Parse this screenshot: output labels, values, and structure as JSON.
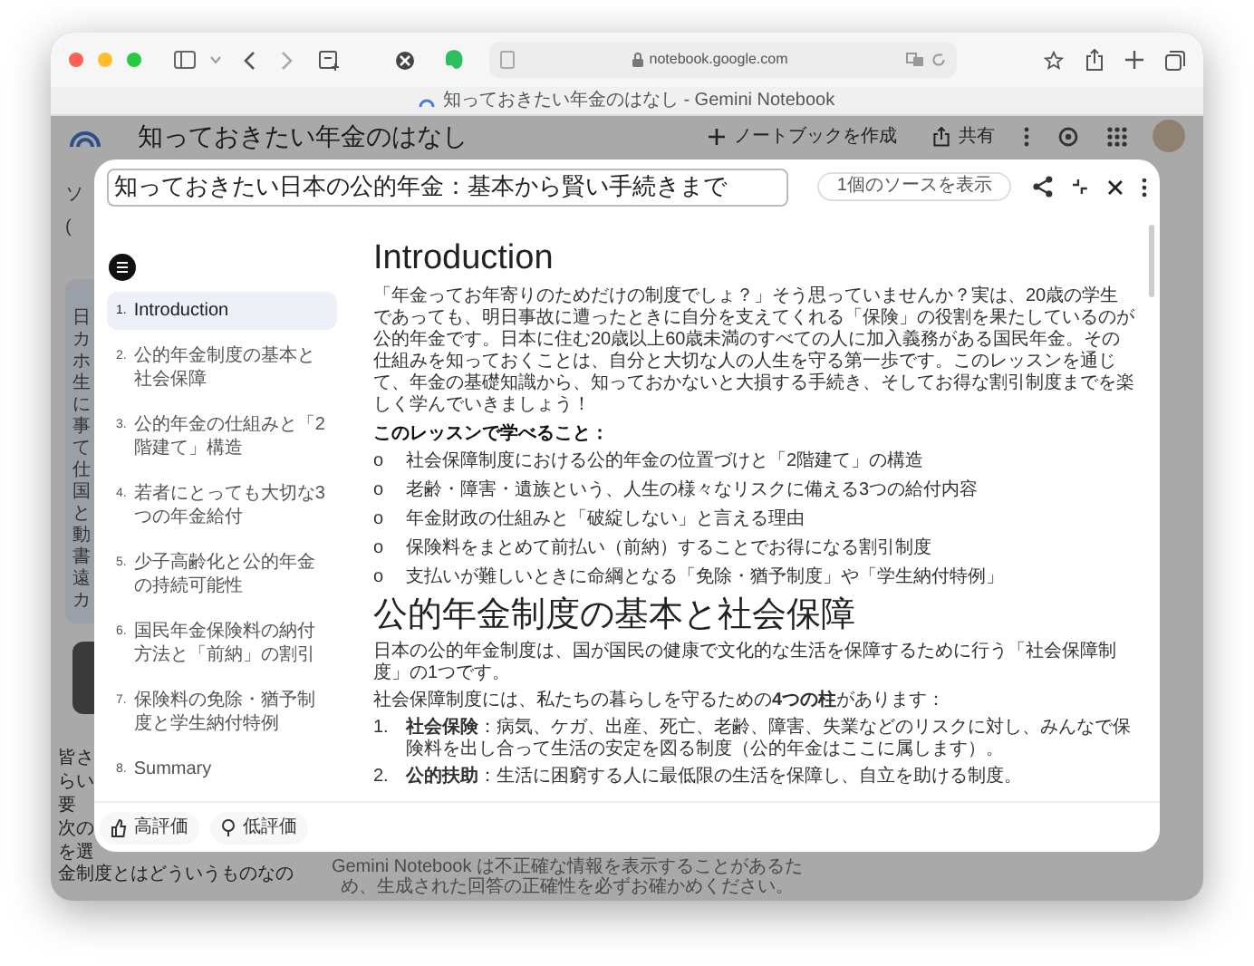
{
  "browser": {
    "url": "notebook.google.com",
    "tab_title": "知っておきたい年金のはなし - Gemini Notebook"
  },
  "app_header": {
    "title": "知っておきたい年金のはなし",
    "create_button": "ノートブックを作成",
    "share_button": "共有"
  },
  "backdrop": {
    "top_fragments": [
      "ソ",
      "("
    ],
    "card_fragments": [
      "日",
      "カ",
      "ホ",
      "生",
      "に",
      "事",
      "て",
      "仕",
      "国",
      "と",
      "動",
      "書",
      "遠",
      "カ"
    ],
    "bottom_fragments": [
      "皆さ",
      "らい",
      "要",
      "次の",
      "を選"
    ],
    "last_line": "金制度とはどういうものなの"
  },
  "modal": {
    "title_value": "知っておきたい日本の公的年金：基本から賢い手続きまで",
    "sources_button": "1個のソースを表示",
    "toc": [
      {
        "number": "1.",
        "label": "Introduction",
        "selected": true
      },
      {
        "number": "2.",
        "label": "公的年金制度の基本と社会保障",
        "selected": false
      },
      {
        "number": "3.",
        "label": "公的年金の仕組みと「2階建て」構造",
        "selected": false
      },
      {
        "number": "4.",
        "label": "若者にとっても大切な3つの年金給付",
        "selected": false
      },
      {
        "number": "5.",
        "label": "少子高齢化と公的年金の持続可能性",
        "selected": false
      },
      {
        "number": "6.",
        "label": "国民年金保険料の納付方法と「前納」の割引",
        "selected": false
      },
      {
        "number": "7.",
        "label": "保険料の免除・猶予制度と学生納付特例",
        "selected": false
      },
      {
        "number": "8.",
        "label": "Summary",
        "selected": false
      }
    ],
    "content": {
      "heading": "Introduction",
      "intro": "「年金ってお年寄りのためだけの制度でしょ？」そう思っていませんか？実は、20歳の学生であっても、明日事故に遭ったときに自分を支えてくれる「保険」の役割を果たしているのが公的年金です。日本に住む20歳以上60歳未満のすべての人に加入義務がある国民年金。その仕組みを知っておくことは、自分と大切な人の人生を守る第一歩です。このレッスンを通じて、年金の基礎知識から、知っておかないと大損する手続き、そしてお得な割引制度までを楽しく学んでいきましょう！",
      "learn_heading": "このレッスンで学べること：",
      "learn_items": [
        {
          "marker": "o",
          "text": "社会保障制度における公的年金の位置づけと「2階建て」の構造"
        },
        {
          "marker": "o",
          "text": "老齢・障害・遺族という、人生の様々なリスクに備える3つの給付内容"
        },
        {
          "marker": "o",
          "text": "年金財政の仕組みと「破綻しない」と言える理由"
        },
        {
          "marker": "o",
          "text": "保険料をまとめて前払い（前納）することでお得になる割引制度"
        },
        {
          "marker": "o",
          "text": "支払いが難しいときに命綱となる「免除・猶予制度」や「学生納付特例」"
        }
      ],
      "section_heading": "公的年金制度の基本と社会保障",
      "section_paragraphs": [
        "日本の公的年金制度は、国が国民の健康で文化的な生活を保障するために行う「社会保障制度」の1つです。",
        "社会保障制度には、私たちの暮らしを守るための**4つの柱**があります："
      ],
      "pillars": [
        {
          "number": "1.",
          "text": "**社会保険**：病気、ケガ、出産、死亡、老齢、障害、失業などのリスクに対し、みんなで保険料を出し合って生活の安定を図る制度（公的年金はここに属します）。"
        },
        {
          "number": "2.",
          "text": "**公的扶助**：生活に困窮する人に最低限の生活を保障し、自立を助ける制度。"
        }
      ]
    },
    "feedback": [
      "高評価",
      "低評価"
    ]
  },
  "disclaimer": "Gemini Notebook は不正確な情報を表示することがあるため、生成された回答の正確性を必ずお確かめください。"
}
